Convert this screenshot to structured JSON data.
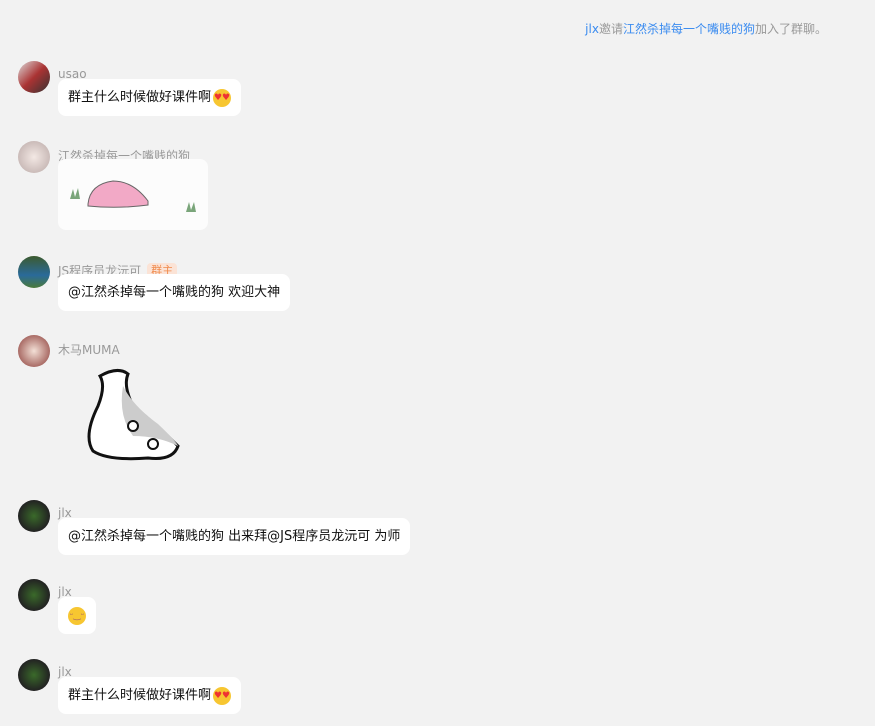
{
  "system_notice": {
    "inviter": "jlx",
    "action": "邀请",
    "invitee": "江然杀掉每一个嘴贱的狗",
    "suffix": "加入了群聊。"
  },
  "colors": {
    "link": "#3b8cf0",
    "badge_text": "#f08a4b",
    "badge_bg": "#fbe3d6",
    "bg": "#f2f2f2"
  },
  "messages": [
    {
      "sender": "usao",
      "text": "群主什么时候做好课件啊",
      "emoji": "heart-eyes-emoji"
    },
    {
      "sender": "江然杀掉每一个嘴贱的狗",
      "image": "pink-blob-sticker"
    },
    {
      "sender": "JS程序员龙沅可",
      "badge": "群主",
      "text": "@江然杀掉每一个嘴贱的狗 欢迎大神"
    },
    {
      "sender": "木马MUMA",
      "image": "seal-sticker"
    },
    {
      "sender": "jlx",
      "text": "@江然杀掉每一个嘴贱的狗 出来拜@JS程序员龙沅可 为师"
    },
    {
      "sender": "jlx",
      "emoji": "grin-emoji"
    },
    {
      "sender": "jlx",
      "text": "群主什么时候做好课件啊",
      "emoji": "heart-eyes-emoji"
    }
  ]
}
